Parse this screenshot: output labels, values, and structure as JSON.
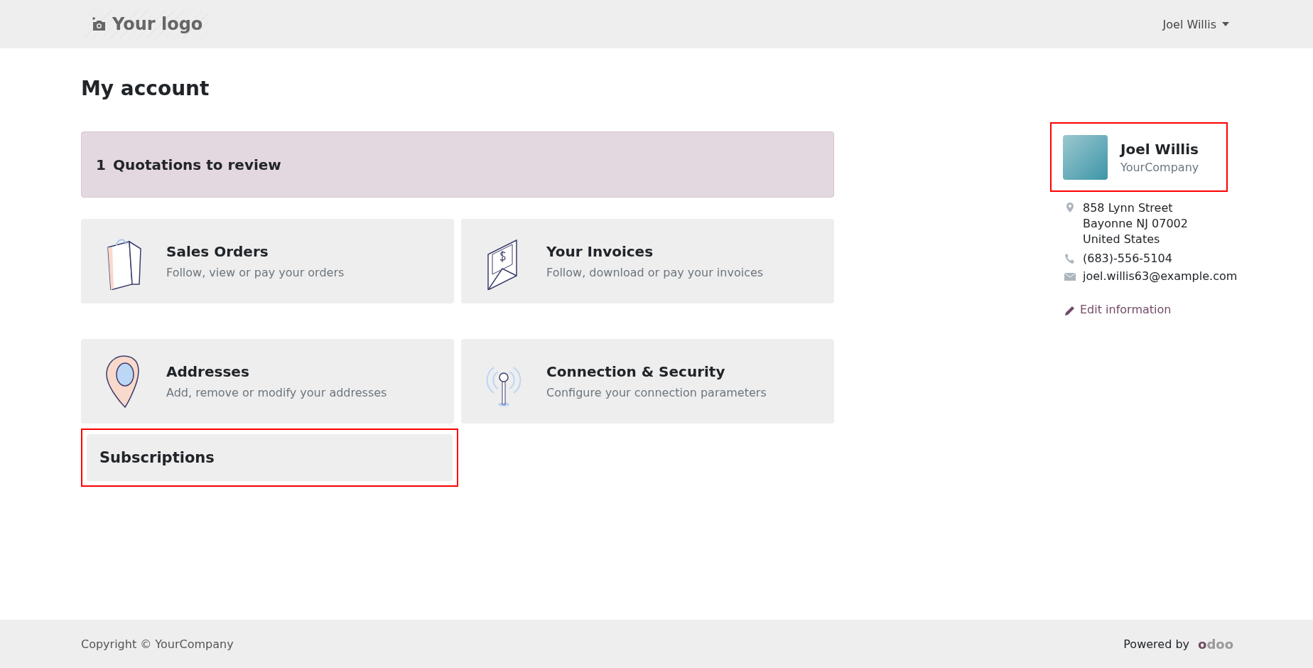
{
  "header": {
    "logo": "Your logo",
    "user_menu": "Joel Willis"
  },
  "page_title": "My account",
  "alert": {
    "count": "1",
    "text": "Quotations to review"
  },
  "cards": [
    {
      "kind": "bag",
      "title": "Sales Orders",
      "subtitle": "Follow, view or pay your orders"
    },
    {
      "kind": "invoice",
      "title": "Your Invoices",
      "subtitle": "Follow, download or pay your invoices"
    },
    {
      "kind": "pin",
      "title": "Addresses",
      "subtitle": "Add, remove or modify your addresses"
    },
    {
      "kind": "antenna",
      "title": "Connection & Security",
      "subtitle": "Configure your connection parameters"
    }
  ],
  "subscriptions": {
    "title": "Subscriptions",
    "highlighted": true
  },
  "profile": {
    "name": "Joel Willis",
    "company": "YourCompany",
    "highlighted": true,
    "address": [
      "858 Lynn Street",
      "Bayonne NJ 07002",
      "United States"
    ],
    "phone": "(683)-556-5104",
    "email": "joel.willis63@example.com",
    "edit_link": "Edit information"
  },
  "footer": {
    "copyright": "Copyright © YourCompany",
    "powered_by": "Powered by",
    "brand": "odoo"
  }
}
